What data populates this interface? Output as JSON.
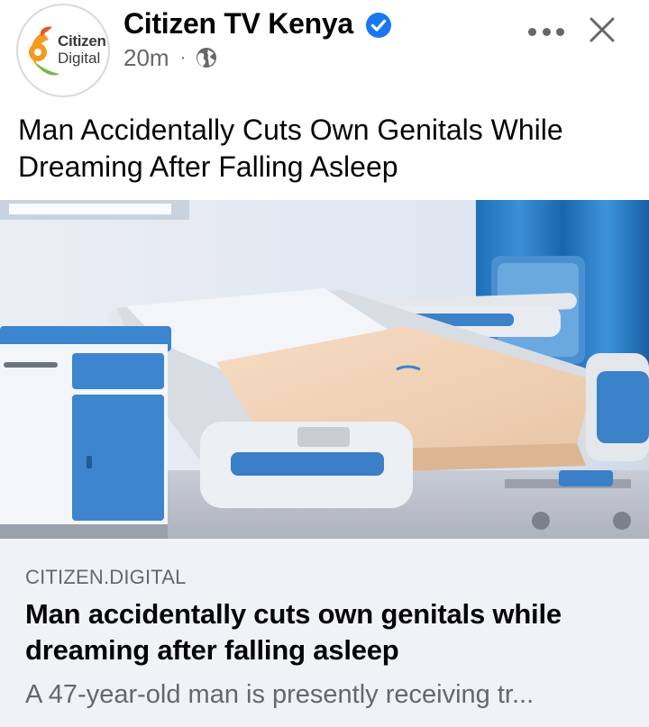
{
  "post": {
    "page_name": "Citizen TV Kenya",
    "verified": true,
    "time_ago": "20m",
    "separator": "·",
    "audience_icon": "globe-icon",
    "avatar": {
      "line1": "Citizen",
      "line2": "Digital"
    },
    "text": "Man Accidentally Cuts Own Genitals While Dreaming After Falling Asleep"
  },
  "image": {
    "subject": "hospital bed beside blue bedside cabinet"
  },
  "link_preview": {
    "domain": "CITIZEN.DIGITAL",
    "title": "Man accidentally cuts own genitals while dreaming after falling asleep",
    "description": "A 47-year-old man is presently receiving tr..."
  },
  "icons": [
    "verified-badge-icon",
    "globe-icon",
    "more-options-icon",
    "close-icon"
  ],
  "colors": {
    "verified_blue": "#1877f2",
    "meta_gray": "#65676b",
    "preview_bg": "#f0f2f5",
    "brand_orange": "#f39a1e",
    "brand_green": "#7ab648"
  }
}
